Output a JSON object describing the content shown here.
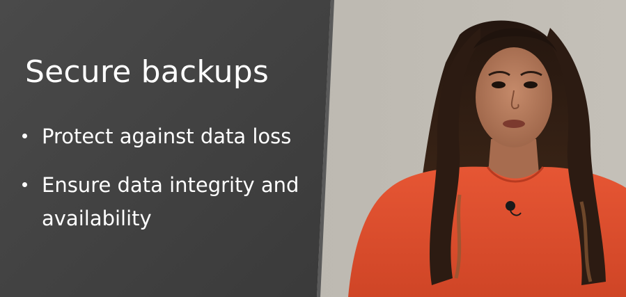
{
  "slide": {
    "title": "Secure backups",
    "bullets": [
      "Protect against data loss",
      "Ensure data integrity and availability"
    ]
  },
  "colors": {
    "panel": "#3f3f3f",
    "wall": "#b9b5ad",
    "dress": "#e0502f",
    "hair": "#2a1a12",
    "skin": "#b57a5c",
    "text": "#ffffff"
  }
}
